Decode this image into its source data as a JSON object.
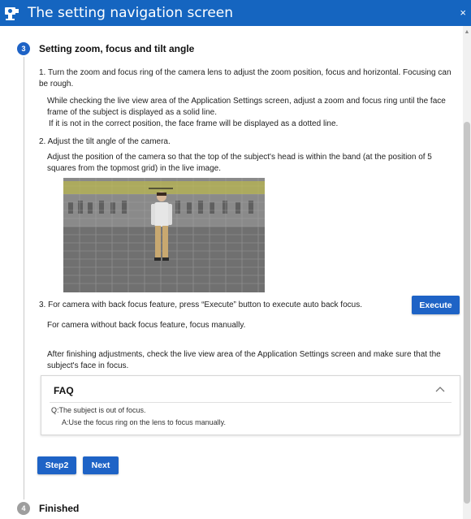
{
  "window": {
    "title": "The setting navigation screen",
    "close_glyph": "×"
  },
  "steps": [
    {
      "number": "3",
      "title": "Setting zoom, focus and tilt angle",
      "state": "active"
    },
    {
      "number": "4",
      "title": "Finished",
      "state": "inactive"
    }
  ],
  "instructions": {
    "item1": "1. Turn the zoom and focus ring of the camera lens to adjust the zoom position, focus and horizontal. Focusing can be rough.",
    "item1_note_a": "While checking the live view area of the Application Settings screen, adjust a zoom and focus ring until the face frame of the subject is displayed as a solid line.",
    "item1_note_b": "If it is not in the correct position, the face frame will be displayed as a dotted line.",
    "item2": "2. Adjust the tilt angle of the camera.",
    "item2_note": "Adjust the position of the camera so that the top of the subject's head is within the band (at the position of 5 squares from the topmost grid) in the live image.",
    "item3": "3. For camera with back focus feature, press “Execute” button to execute auto back focus.",
    "item3_note": "For camera without back focus feature, focus manually.",
    "final_note": "After finishing adjustments, check the live view area of the Application Settings screen and make sure that the subject's face in focus."
  },
  "buttons": {
    "execute": "Execute",
    "step2": "Step2",
    "next": "Next"
  },
  "faq": {
    "title": "FAQ",
    "expanded": true,
    "question": "Q:The subject is out of focus.",
    "answer": "A:Use the focus ring on the lens to focus manually."
  },
  "colors": {
    "titlebar": "#1565c0",
    "accent": "#1e63c6",
    "band": "#c8c43a"
  },
  "icons": {
    "app": "camera-gear-icon",
    "close": "close-icon",
    "collapse": "chevron-up-icon"
  }
}
